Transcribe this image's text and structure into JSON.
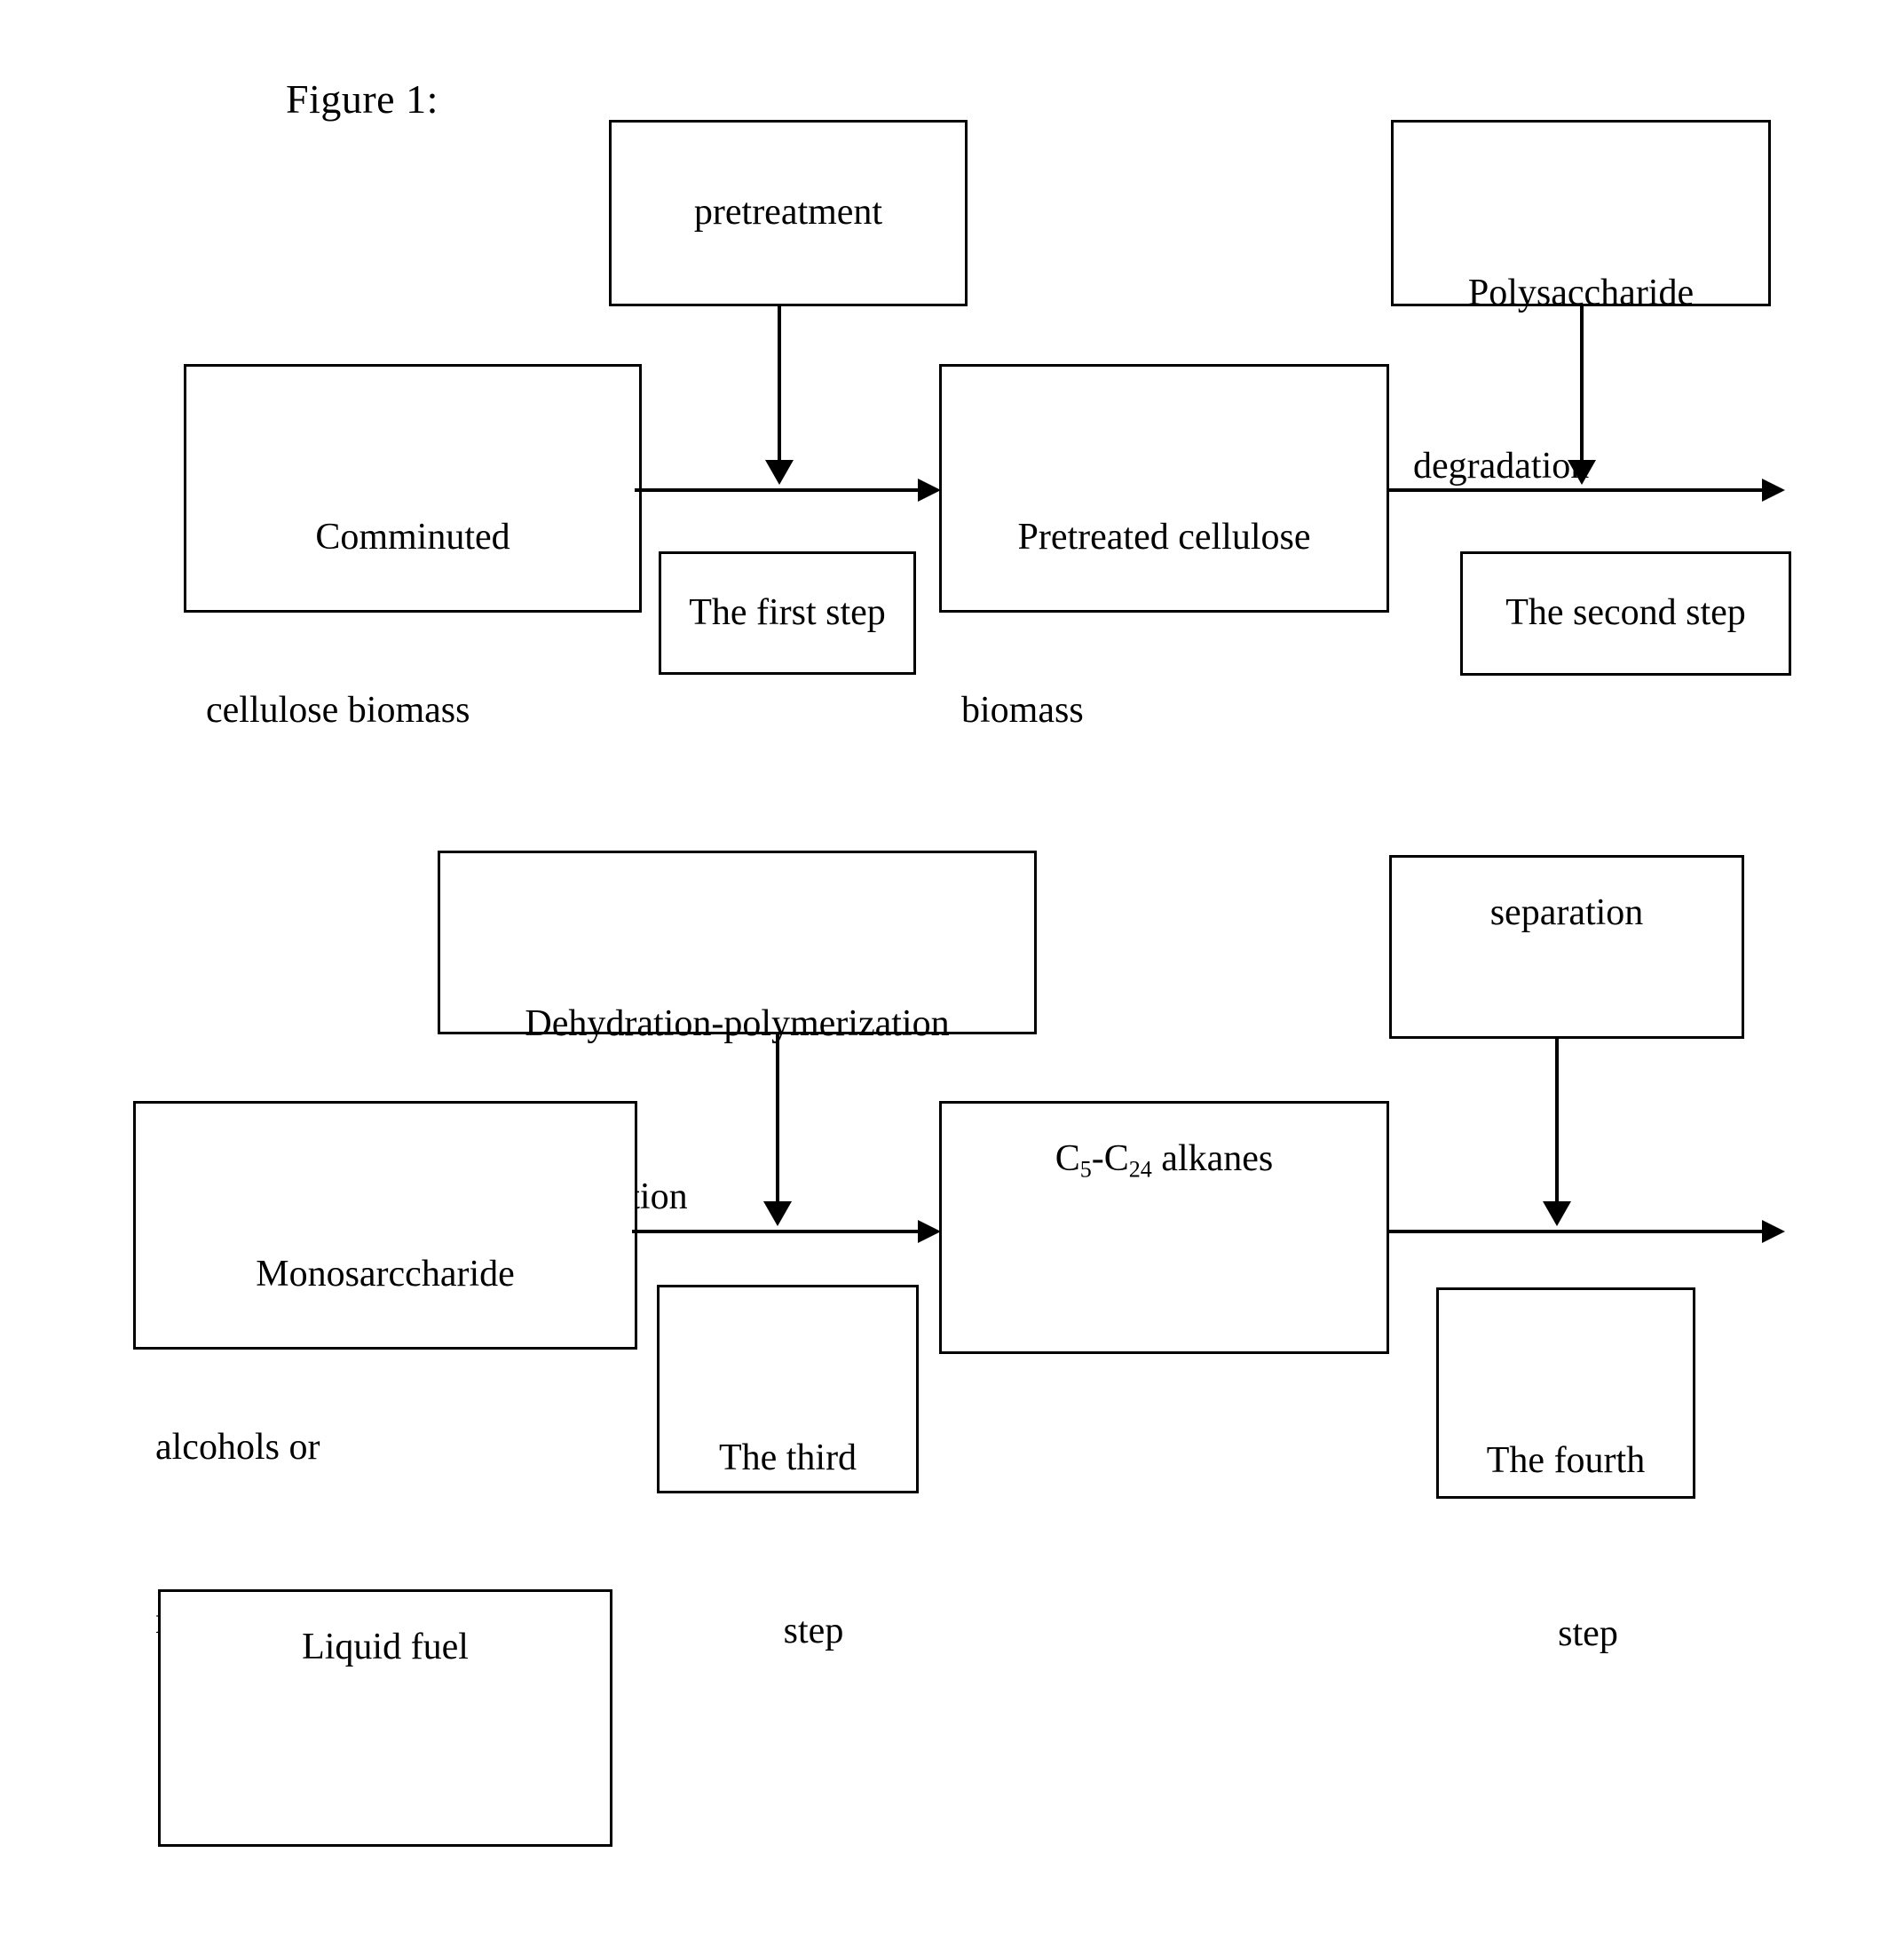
{
  "figure": {
    "label": "Figure 1:"
  },
  "nodes": {
    "pretreatment": {
      "label": "pretreatment"
    },
    "polysaccharide_degradation": {
      "line1": "Polysaccharide",
      "line2": "degradation"
    },
    "comminuted_biomass": {
      "line1": "Comminuted",
      "line2": "cellulose biomass"
    },
    "pretreated_biomass": {
      "line1": "Pretreated cellulose",
      "line2": "biomass"
    },
    "first_step": {
      "label": "The first step"
    },
    "second_step": {
      "label": "The second step"
    },
    "dehydration": {
      "line1": "Dehydration-polymerization",
      "line2": "-hydrogenation"
    },
    "separation": {
      "label": "separation"
    },
    "monosaccharide": {
      "line1": "Monosarccharide",
      "line2": "alcohols or",
      "line3": "monosaccharides"
    },
    "alkanes": {
      "prefix": "C",
      "sub1": "5",
      "dash": "-C",
      "sub2": "24",
      "suffix": " alkanes"
    },
    "third_step": {
      "line1": "The third",
      "line2": "step"
    },
    "fourth_step": {
      "line1": "The fourth",
      "line2": "step"
    },
    "liquid_fuel": {
      "label": "Liquid fuel"
    }
  },
  "colors": {
    "ink": "#000000",
    "page": "#ffffff"
  }
}
